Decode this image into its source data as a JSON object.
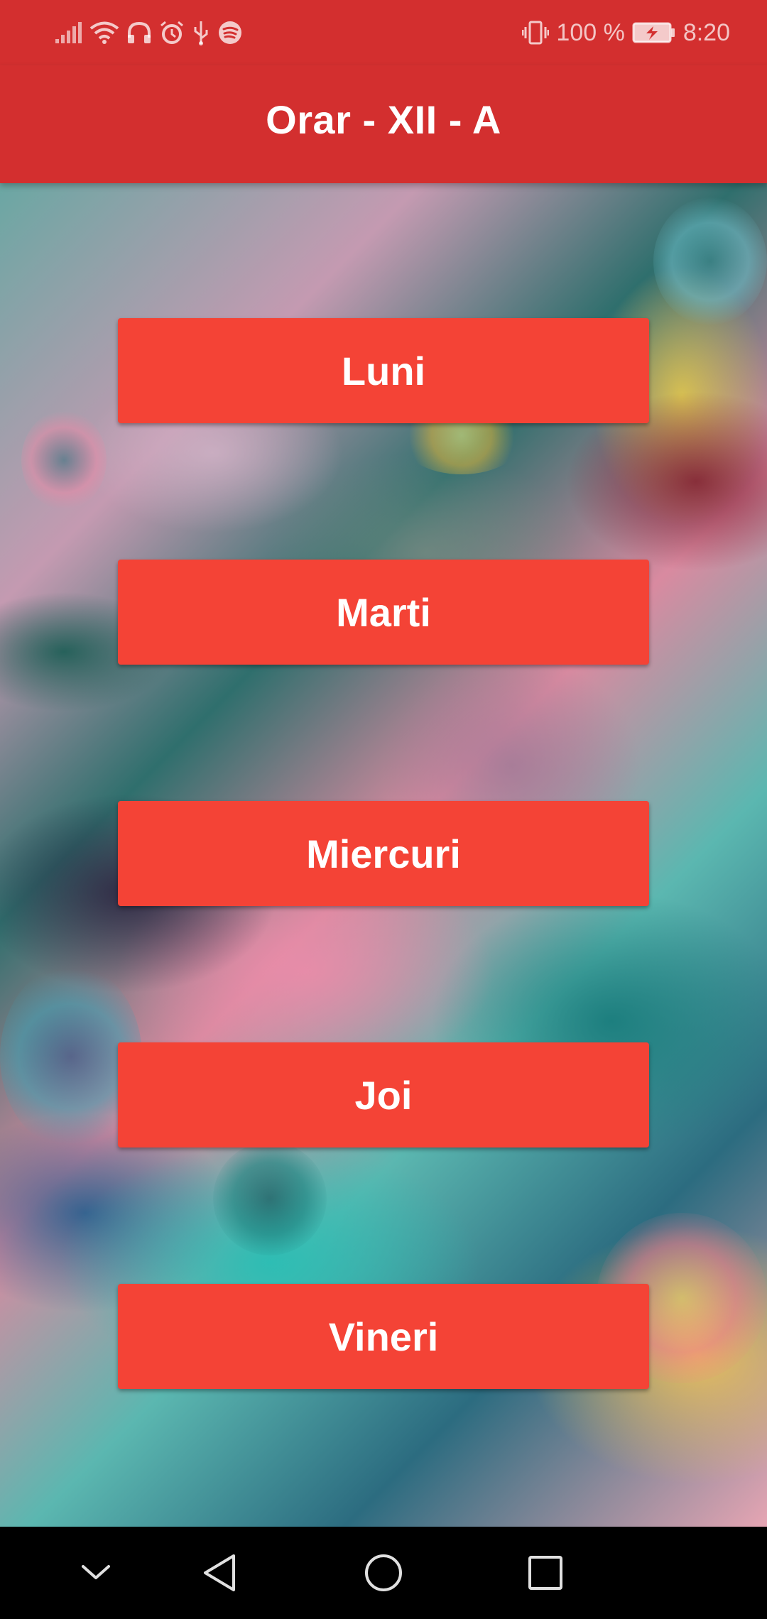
{
  "status_bar": {
    "battery_percent": "100 %",
    "time": "8:20",
    "icons_left": [
      "signal-icon",
      "wifi-icon",
      "headphones-icon",
      "alarm-icon",
      "usb-icon",
      "spotify-icon"
    ],
    "icons_right": [
      "vibrate-icon",
      "battery-charging-icon"
    ]
  },
  "app_bar": {
    "title": "Orar - XII - A",
    "color": "#d32f2f"
  },
  "days": [
    {
      "label": "Luni"
    },
    {
      "label": "Marti"
    },
    {
      "label": "Miercuri"
    },
    {
      "label": "Joi"
    },
    {
      "label": "Vineri"
    }
  ],
  "button_color": "#f44336",
  "nav_bar": {
    "icons": [
      "hide-nav-icon",
      "back-icon",
      "home-icon",
      "recents-icon"
    ]
  }
}
